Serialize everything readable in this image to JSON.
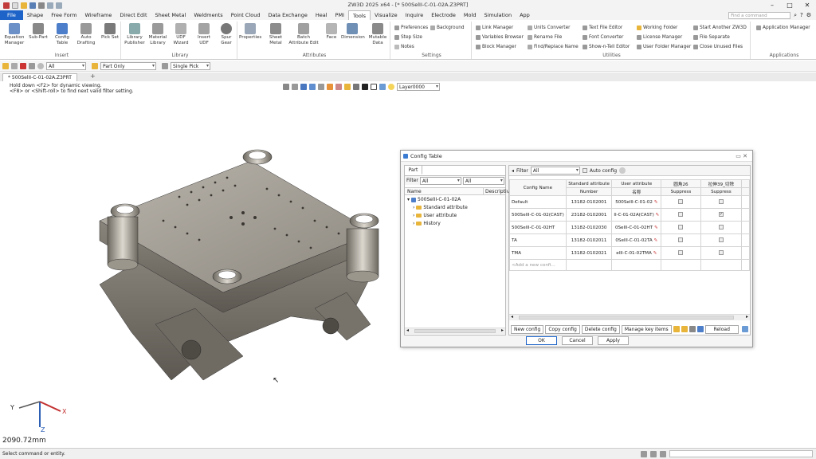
{
  "window": {
    "title": "ZW3D 2025 x64 - [* 500SelII-C-01-02A.Z3PRT]",
    "controls": [
      "–",
      "□",
      "✕"
    ]
  },
  "menu": {
    "tabs": [
      "File",
      "Shape",
      "Free Form",
      "Wireframe",
      "Direct Edit",
      "Sheet Metal",
      "Weldments",
      "Point Cloud",
      "Data Exchange",
      "Heal",
      "PMI",
      "Tools",
      "Visualize",
      "Inquire",
      "Electrode",
      "Mold",
      "Simulation",
      "App"
    ],
    "active": "Tools",
    "search_placeholder": "Find a command"
  },
  "ribbon": {
    "groups": {
      "insert": {
        "name": "Insert",
        "buttons": [
          "Equation Manager",
          "Sub-Part",
          "Config Table",
          "Auto Drafting",
          "Pick Set"
        ]
      },
      "library": {
        "name": "Library",
        "buttons": [
          "Library Publisher",
          "Material Library",
          "UDF Wizard",
          "Insert UDF",
          "Spur Gear"
        ]
      },
      "attributes": {
        "name": "Attributes",
        "buttons": [
          "Properties",
          "Sheet Metal",
          "Batch Attribute Edit",
          "Face",
          "Dimension",
          "Mutable Data"
        ]
      },
      "settings": {
        "name": "Settings",
        "items": [
          "Preferences",
          "Background",
          "Step Size",
          "Notes"
        ]
      },
      "utilities": {
        "name": "Utilities",
        "items": [
          "Link Manager",
          "Variables Browser",
          "Block Manager",
          "Units Converter",
          "Rename File",
          "Find/Replace Name",
          "Text File Editor",
          "Font Converter",
          "Show-n-Tell Editor",
          "Working Folder",
          "License Manager",
          "User Folder Manager",
          "Start Another ZW3D",
          "File Separate",
          "Close Unused Files"
        ]
      },
      "applications": {
        "name": "Applications",
        "items": [
          "Application Manager"
        ]
      }
    }
  },
  "filterbar": {
    "filter_value": "All",
    "pick_mode": "Part Only",
    "pick_type": "Single Pick"
  },
  "doc_tab": {
    "label": "* 500SelII-C-01-02A.Z3PRT",
    "add": "+"
  },
  "viewport": {
    "hint_line1": "Hold down <F2> for dynamic viewing.",
    "hint_line2": "<F8> or <Shift-roll> to find next valid filter setting.",
    "layer": "Layer0000",
    "scale": "2090.72mm",
    "triad": {
      "x": "X",
      "y": "Y",
      "z": "Z"
    }
  },
  "status": {
    "prompt": "Select command or entity."
  },
  "config_dialog": {
    "title": "Config Table",
    "left": {
      "tab": "Part",
      "filter_label": "Filter",
      "filter1": "All",
      "filter2": "All",
      "col_name": "Name",
      "col_desc": "Descriptiv",
      "tree": {
        "root": "500SelII-C-01-02A",
        "children": [
          "Standard attribute",
          "User attribute",
          "History"
        ]
      }
    },
    "right": {
      "filter_label": "Filter",
      "filter_value": "All",
      "auto_config": "Auto config",
      "headers_top": [
        "Config Name",
        "Standard attribute",
        "User attribute",
        "圆角26",
        "拉伸39_切除"
      ],
      "headers_sub": [
        "Number",
        "名称",
        "Suppress",
        "Suppress"
      ],
      "rows": [
        {
          "name": "Default",
          "number": "13182-0102001",
          "user": "500SelII-C-01-02",
          "s1": false,
          "s2": false
        },
        {
          "name": "500SelII-C-01-02(CAST)",
          "number": "23182-0102001",
          "user": "II-C-01-02A(CAST)",
          "s1": false,
          "s2": true
        },
        {
          "name": "500SelII-C-01-02HT",
          "number": "13182-0102030",
          "user": "0SelII-C-01-02HT",
          "s1": false,
          "s2": false
        },
        {
          "name": "TA",
          "number": "13182-0102011",
          "user": "0SelII-C-01-02TA",
          "s1": false,
          "s2": false
        },
        {
          "name": "TMA",
          "number": "13182-0102021",
          "user": "elII-C-01-02TMA",
          "s1": false,
          "s2": false
        }
      ],
      "add_row": "<Add a new confi...",
      "buttons": [
        "New config",
        "Copy config",
        "Delete config",
        "Manage key items",
        "Reload"
      ]
    },
    "footer": [
      "OK",
      "Cancel",
      "Apply"
    ]
  }
}
